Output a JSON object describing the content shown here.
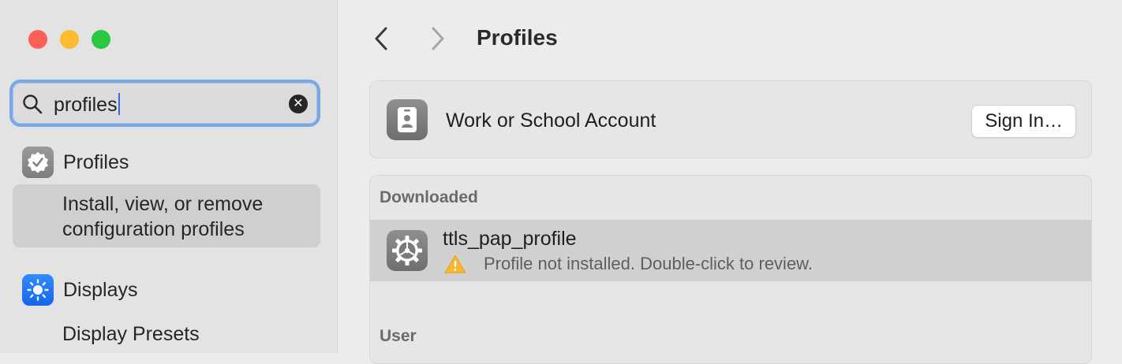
{
  "sidebar": {
    "search": {
      "query": "profiles"
    },
    "results": [
      {
        "icon": "checkmark-seal-icon",
        "category": "Profiles",
        "detail": "Install, view, or remove configuration profiles"
      },
      {
        "icon": "sun-icon",
        "category": "Displays",
        "detail": "Display Presets"
      }
    ]
  },
  "main": {
    "title": "Profiles",
    "account": {
      "label": "Work or School Account",
      "button": "Sign In…"
    },
    "sections": {
      "downloaded": {
        "header": "Downloaded",
        "items": [
          {
            "name": "ttls_pap_profile",
            "status": "Profile not installed. Double-click to review."
          }
        ]
      },
      "user": {
        "header": "User"
      }
    }
  },
  "colors": {
    "accent": "#2f6fe0",
    "focus_ring": "#7aa7e6",
    "selection": "#d0d0d0",
    "warning": "#f5b82e",
    "displays_icon": "#1f78f5"
  }
}
